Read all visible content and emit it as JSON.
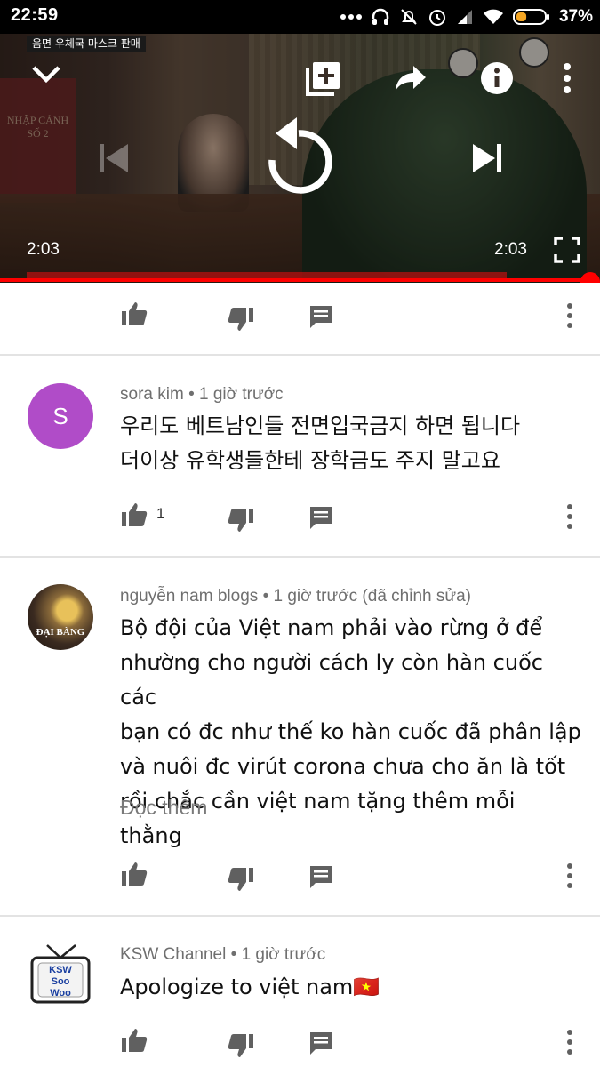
{
  "status_bar": {
    "time": "22:59",
    "battery_pct": "37%",
    "battery_level": 0.37,
    "icons": [
      "more-dots-icon",
      "headphones-icon",
      "mute-icon",
      "alarm-icon",
      "signal-icon",
      "wifi-icon",
      "battery-icon"
    ]
  },
  "player": {
    "caption_tag": "음면 우체국 마스크 판매",
    "sign_text": "NHẬP CẢNH SỐ 2",
    "time_left": "2:03",
    "time_right": "2:03",
    "progress": 1.0,
    "accent": "#ff0000"
  },
  "comments": [
    {
      "author": "sora kim",
      "when": "1 giờ trước",
      "avatar_letter": "S",
      "avatar_color": "#b04cc8",
      "text_lines": [
        "우리도 베트남인들 전면입국금지 하면 됩니다",
        "더이상 유학생들한테 장학금도 주지 말고요"
      ],
      "likes": "1"
    },
    {
      "author": "nguyễn nam blogs",
      "when": "1 giờ trước (đã chỉnh sửa)",
      "avatar_text": "ĐẠI BÀNG",
      "text_lines": [
        "Bộ đội của Việt nam phải vào rừng ở để",
        "nhường cho người cách ly còn hàn cuốc các",
        "bạn có đc như thế ko hàn cuốc đã phân lập",
        "và nuôi đc virút corona chưa cho ăn là tốt",
        "rồi chắc cần việt nam tặng thêm mỗi thằng"
      ],
      "read_more": "Đọc thêm"
    },
    {
      "author": "KSW Channel",
      "when": "1 giờ trước",
      "avatar_text": "KSW Soo Woo",
      "text": "Apologize to việt nam",
      "flag": "🇻🇳"
    }
  ]
}
